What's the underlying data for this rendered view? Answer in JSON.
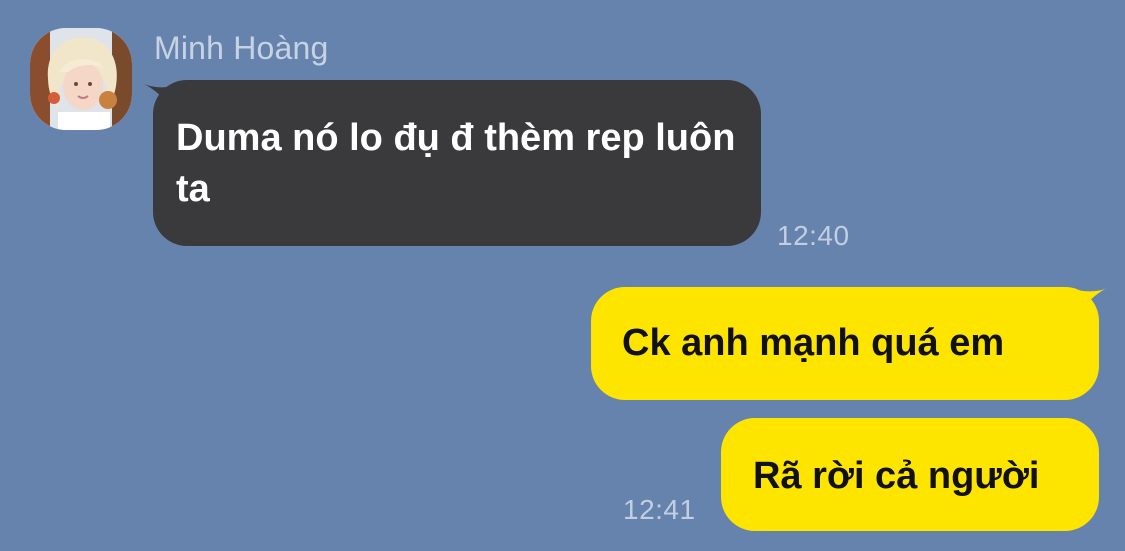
{
  "conversation": {
    "incoming": {
      "sender_name": "Minh Hoàng",
      "avatar_icon": "user-avatar-photo",
      "message_text": "Duma nó lo đụ đ thèm rep luôn ta",
      "time": "12:40",
      "bubble_color": "#3a3a3c"
    },
    "outgoing": [
      {
        "message_text": "Ck anh mạnh quá em"
      },
      {
        "message_text": "Rã rời cả người"
      }
    ],
    "outgoing_time": "12:41",
    "outgoing_bubble_color": "#fee500",
    "background_color": "#6683ad"
  }
}
